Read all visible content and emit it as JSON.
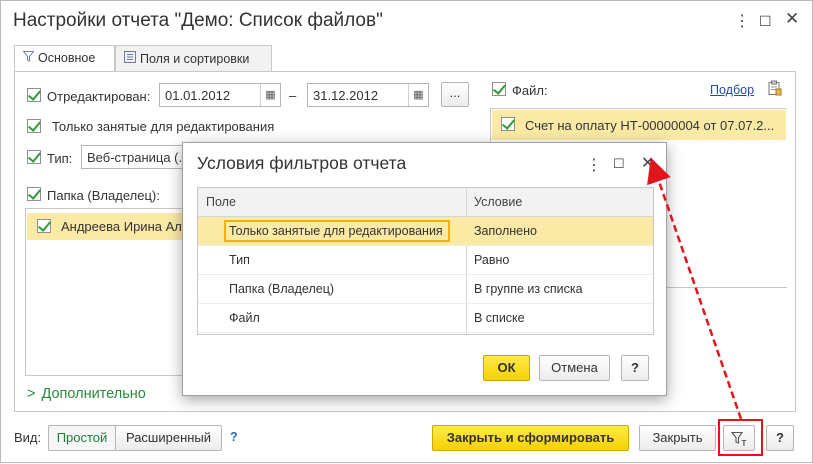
{
  "window": {
    "title": "Настройки отчета \"Демо: Список файлов\"",
    "menu_icon": "more-vertical-icon",
    "maximize_icon": "maximize-icon",
    "close_icon": "close-icon"
  },
  "tabs": [
    {
      "label": "Основное",
      "icon": "filter-icon",
      "active": true
    },
    {
      "label": "Поля и сортировки",
      "icon": "fields-icon",
      "active": false
    }
  ],
  "filters": {
    "edited": {
      "label": "Отредактирован:",
      "checked": true,
      "from": "01.01.2012",
      "dash": "–",
      "to": "31.12.2012",
      "more_label": "..."
    },
    "only_busy": {
      "label": "Только занятые для редактирования",
      "checked": true
    },
    "type": {
      "label": "Тип:",
      "checked": true,
      "value": "Веб-страница (.h"
    },
    "folder": {
      "label": "Папка (Владелец):",
      "checked": true,
      "items": [
        {
          "label": "Андреева Ирина Але",
          "checked": true
        }
      ]
    },
    "file": {
      "label": "Файл:",
      "checked": true,
      "pick_label": "Подбор",
      "items": [
        {
          "label": "Счет на оплату НТ-00000004 от 07.07.2...",
          "checked": true
        }
      ]
    }
  },
  "more_section": {
    "label": "Дополнительно"
  },
  "footer": {
    "view_label": "Вид:",
    "view_simple": "Простой",
    "view_extended": "Расширенный",
    "help_link": "?",
    "close_and_run": "Закрыть и сформировать",
    "close": "Закрыть",
    "filter_conditions_icon": "filter-conditions-icon",
    "help": "?"
  },
  "dialog": {
    "title": "Условия фильтров отчета",
    "columns": [
      "Поле",
      "Условие"
    ],
    "rows": [
      {
        "field": "Только занятые для редактирования",
        "condition": "Заполнено"
      },
      {
        "field": "Тип",
        "condition": "Равно"
      },
      {
        "field": "Папка (Владелец)",
        "condition": "В группе из списка"
      },
      {
        "field": "Файл",
        "condition": "В списке"
      }
    ],
    "ok": "ОК",
    "cancel": "Отмена",
    "help": "?"
  },
  "colors": {
    "accent_yellow": "#f5d200",
    "selection": "#fbeaa5",
    "annotation_red": "#e0161c",
    "check_green": "#2f9c37"
  }
}
